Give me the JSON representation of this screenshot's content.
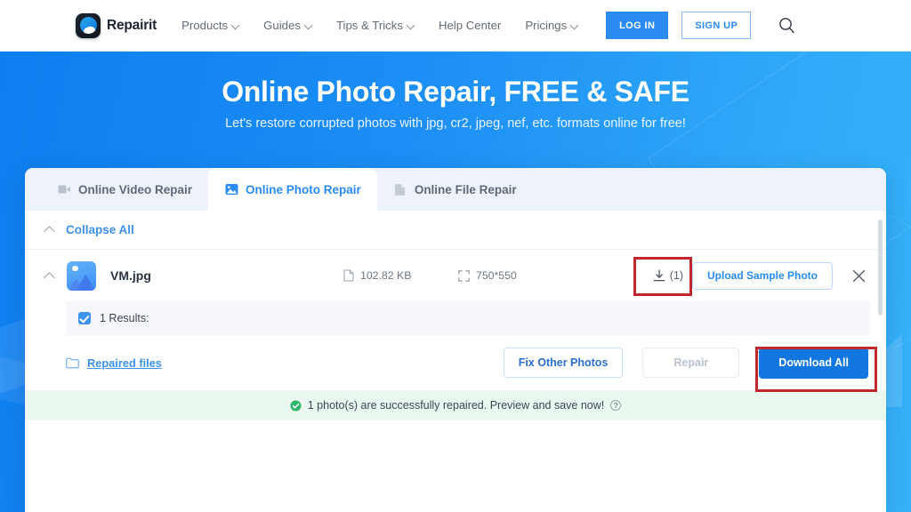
{
  "nav": {
    "brand": "Repairit",
    "links": [
      {
        "label": "Products",
        "caret": true
      },
      {
        "label": "Guides",
        "caret": true
      },
      {
        "label": "Tips & Tricks",
        "caret": true
      },
      {
        "label": "Help Center",
        "caret": false
      },
      {
        "label": "Pricings",
        "caret": true
      }
    ],
    "login_label": "LOG IN",
    "signup_label": "SIGN UP",
    "search_icon": "search-icon"
  },
  "hero": {
    "title": "Online Photo Repair, FREE & SAFE",
    "subtitle": "Let's restore corrupted photos with jpg, cr2, jpeg, nef, etc. formats online for free!"
  },
  "panel": {
    "tabs": [
      {
        "label": "Online Video Repair",
        "icon": "video-camera-icon",
        "active": false
      },
      {
        "label": "Online Photo Repair",
        "icon": "image-icon",
        "active": true
      },
      {
        "label": "Online File Repair",
        "icon": "file-icon",
        "active": false
      }
    ],
    "collapse_label": "Collapse All",
    "file": {
      "name": "VM.jpg",
      "size": "102.82 KB",
      "dimensions": "750*550",
      "download_count": "(1)",
      "upload_sample_label": "Upload Sample Photo",
      "thumbnail_icon": "image-thumbnail-icon",
      "close_icon": "close-icon"
    },
    "results_label": "1 Results:",
    "repaired_files_label": "Repaired files",
    "fix_other_label": "Fix Other Photos",
    "repair_label": "Repair",
    "download_all_label": "Download All",
    "success_message": "1 photo(s) are successfully repaired. Preview and save now!",
    "help_glyph": "?"
  },
  "colors": {
    "primary_blue": "#2a8bf2",
    "download_blue": "#1277e0",
    "hero_gradient_start": "#0d7ef0",
    "hero_gradient_end": "#36b2f9",
    "success_bg": "#eaf8f0",
    "highlight_red": "#c0282d",
    "disabled_grey": "#b9c2cd"
  }
}
